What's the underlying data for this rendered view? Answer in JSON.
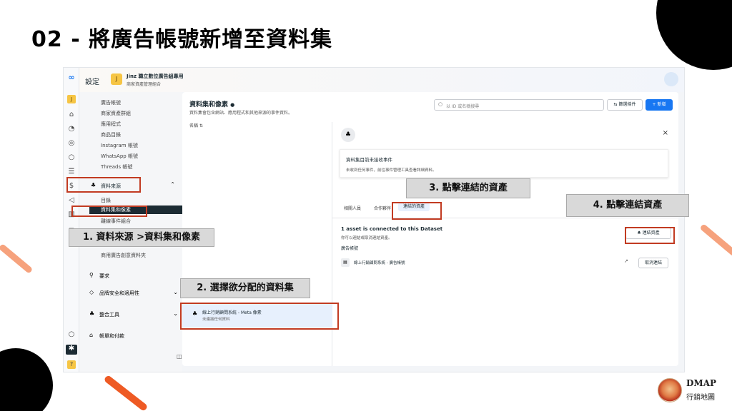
{
  "slide_title": "02 - 將廣告帳號新增至資料集",
  "topbar": {
    "settings_label": "設定",
    "account_avatar": "J",
    "account_name": "Jinz 職立數位廣告組專用",
    "account_type": "商家資產管理組合"
  },
  "sidebar": {
    "items_top": [
      "廣告帳號",
      "商家資產群組",
      "應用程式",
      "商品目錄",
      "Instagram 帳號",
      "WhatsApp 帳號",
      "Threads 帳號"
    ],
    "data_sources_label": "資料來源",
    "data_sources_children": [
      "目錄",
      "資料集和像素",
      "離線事件組合",
      "商用廣告創意資料夾"
    ],
    "other_sections": [
      "要求",
      "品牌安全和適用性",
      "整合工具",
      "帳單和付款"
    ]
  },
  "content": {
    "title": "資料集和像素",
    "subtitle": "資料集會包含網站、應用程式和其他來源的事件資料。",
    "search_placeholder": "以 ID 或名稱搜尋",
    "filter_button": "篩選條件",
    "add_button": "+ 新增",
    "list_header": "名稱",
    "dataset_name": "線上行銷顧問系統 - Meta 像素",
    "dataset_sub": "未連接任何資料"
  },
  "detail": {
    "notice_title": "資料集目前未接收事件",
    "notice_body": "未收到任何事件，前往事件管理工具查看詳細資料。",
    "tabs": [
      "相關人員",
      "合作夥伴",
      "連結的資產"
    ],
    "connected_title": "1 asset is connected to this Dataset",
    "connected_sub": "你可以連結或取消連結資產。",
    "group_label": "廣告帳號",
    "asset_name": "線上行銷顧問系統 - 廣告帳號",
    "connect_button": "連結資產",
    "disconnect_button": "取消連結"
  },
  "annotations": {
    "step1": "1. 資料來源 >資料集和像素",
    "step2": "2. 選擇欲分配的資料集",
    "step3": "3. 點擊連結的資產",
    "step4": "4. 點擊連結資產"
  },
  "logo": {
    "line1": "DMAP",
    "line2": "行銷地圖"
  }
}
